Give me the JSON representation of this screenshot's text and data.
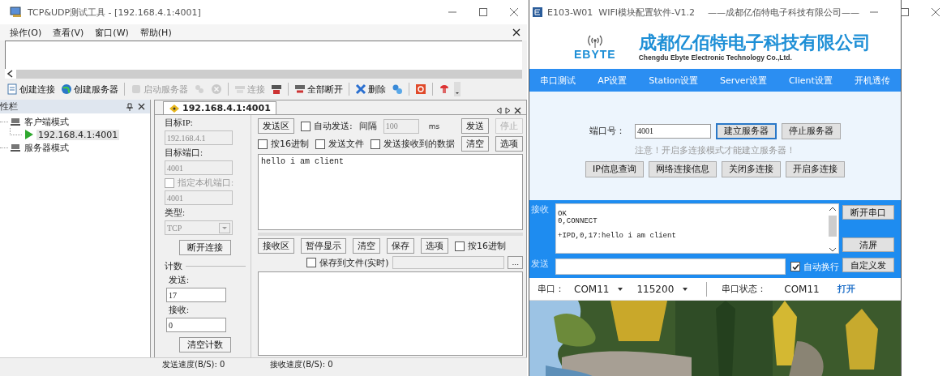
{
  "tcp_tool": {
    "title": "TCP&UDP测试工具 - [192.168.4.1:4001]",
    "menu": [
      "操作(O)",
      "查看(V)",
      "窗口(W)",
      "帮助(H)"
    ],
    "toolbar": [
      [
        {
          "label": "创建连接",
          "disabled": false
        },
        {
          "label": "创建服务器",
          "disabled": false
        }
      ],
      [
        {
          "label": "启动服务器",
          "disabled": true
        },
        {
          "disabled": true
        },
        {
          "disabled": true
        }
      ],
      [
        {
          "label": "连接",
          "disabled": true
        },
        {
          "disabled": false
        }
      ],
      [
        {
          "label": "全部断开",
          "disabled": false
        }
      ],
      [
        {
          "label": "删除",
          "disabled": false
        },
        {
          "disabled": false
        }
      ],
      [
        {
          "disabled": false
        }
      ],
      [
        {
          "disabled": false
        }
      ]
    ],
    "sidebar": {
      "title": "性栏",
      "tree": [
        {
          "label": "客户端模式",
          "selected": false,
          "children": [
            {
              "label": "192.168.4.1:4001",
              "selected": true
            }
          ]
        },
        {
          "label": "服务器模式",
          "selected": false
        }
      ]
    },
    "tab": {
      "label": "192.168.4.1:4001",
      "selected": true
    },
    "connection": {
      "target_ip_label": "目标IP:",
      "target_ip": "192.168.4.1",
      "target_port_label": "目标端口:",
      "target_port": "4001",
      "local_port": {
        "label": "指定本机端口:",
        "checked": false,
        "disabled": true
      },
      "local_port_value": "4001",
      "type_label": "类型:",
      "type": "TCP",
      "disconnect": "断开连接"
    },
    "counter": {
      "title": "计数",
      "sent_label": "发送:",
      "sent": "17",
      "received_label": "接收:",
      "received": "0",
      "clear": "清空计数"
    },
    "send": {
      "area_button": "发送区",
      "auto_send": {
        "label": "自动发送:",
        "checked": false
      },
      "interval_label": "间隔",
      "interval": "100",
      "unit": "ms",
      "send_button": "发送",
      "stop": {
        "label": "停止",
        "disabled": true
      },
      "options": [
        {
          "label": "按16进制",
          "checked": false
        },
        {
          "label": "发送文件",
          "checked": false
        },
        {
          "label": "发送接收到的数据",
          "checked": false
        }
      ],
      "clear": "清空",
      "settings": "选项",
      "text": "hello i am client"
    },
    "receive": {
      "area_button": "接收区",
      "buttons": [
        "暂停显示",
        "清空",
        "保存",
        "选项"
      ],
      "hex": {
        "label": "按16进制",
        "checked": false
      },
      "save_to_file": {
        "label": "保存到文件(实时)",
        "checked": false
      },
      "browse": "..."
    },
    "status_bar": [
      "发送速度(B/S): 0",
      "接收速度(B/S): 0"
    ]
  },
  "ebyte_tool": {
    "title": "E103-W01  WIFI模块配置软件-V1.2",
    "subtitle": "——成都亿佰特电子科技有限公司——",
    "logo": "EBYTE",
    "company": "成都亿佰特电子科技有限公司",
    "company_en": "Chengdu Ebyte Electronic Technology Co.,Ltd.",
    "tabs": [
      {
        "label": "串口测试",
        "selected": false
      },
      {
        "label": "AP设置",
        "selected": false
      },
      {
        "label": "Station设置",
        "selected": false
      },
      {
        "label": "Server设置",
        "selected": false
      },
      {
        "label": "Client设置",
        "selected": false
      },
      {
        "label": "开机透传",
        "selected": false
      }
    ],
    "port_label": "端口号：",
    "port": "4001",
    "server_buttons": [
      {
        "label": "建立服务器",
        "focused": true
      },
      {
        "label": "停止服务器",
        "focused": false
      }
    ],
    "note": "注意！开启多连接模式才能建立服务器！",
    "actions": [
      "IP信息查询",
      "网络连接信息",
      "关闭多连接",
      "开启多连接"
    ],
    "receive_label": "接收",
    "receive_text": "OK\n0,CONNECT\n\n+IPD,0,17:hello i am client",
    "send_label": "发送",
    "auto_newline": {
      "label": "自动换行",
      "checked": true
    },
    "side_buttons": [
      "断开串口",
      "清屏",
      "自定义发"
    ],
    "status": {
      "port_label": "串口：",
      "port": "COM11",
      "baud": "115200",
      "state_label": "串口状态：",
      "state_port": "COM11",
      "action": "打开"
    }
  }
}
